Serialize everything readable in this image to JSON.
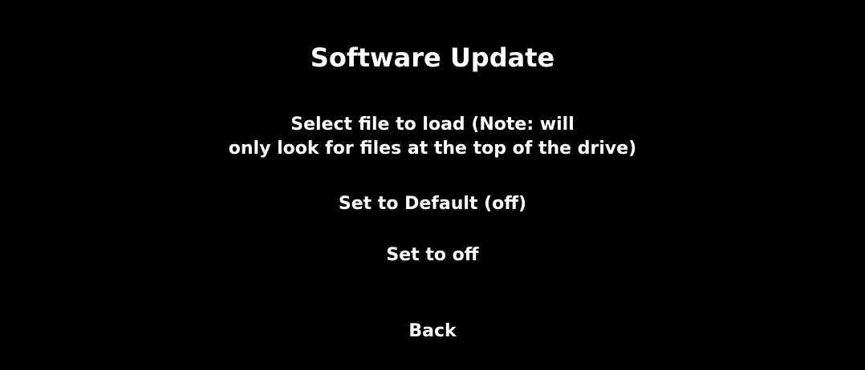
{
  "screen": {
    "title": "Software Update",
    "menu": {
      "select_file_line1": "Select file to load (Note: will",
      "select_file_line2": "only look for files at the top of the drive)",
      "set_default": "Set to Default (off)",
      "set_off": "Set to off",
      "back": "Back"
    },
    "colors": {
      "background": "#000000",
      "text": "#ffffff"
    }
  }
}
